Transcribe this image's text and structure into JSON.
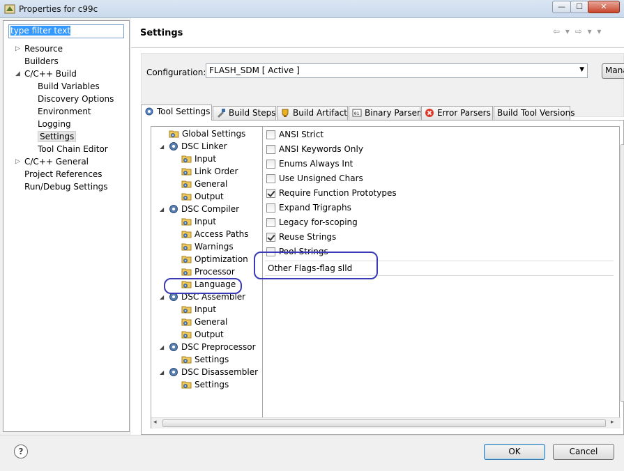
{
  "window": {
    "title": "Properties for c99c"
  },
  "filter": {
    "value": "type filter text"
  },
  "left_tree": [
    {
      "label": "Resource",
      "twisty": "collapsed"
    },
    {
      "label": "Builders"
    },
    {
      "label": "C/C++ Build",
      "twisty": "expanded"
    },
    {
      "label": "Build Variables"
    },
    {
      "label": "Discovery Options"
    },
    {
      "label": "Environment"
    },
    {
      "label": "Logging"
    },
    {
      "label": "Settings",
      "selected": true
    },
    {
      "label": "Tool Chain Editor"
    },
    {
      "label": "C/C++ General",
      "twisty": "collapsed"
    },
    {
      "label": "Project References"
    },
    {
      "label": "Run/Debug Settings"
    }
  ],
  "header": {
    "title": "Settings",
    "nav_arrows": "⇦ ▾ ⇨ ▾ ▾"
  },
  "configuration": {
    "label": "Configuration:",
    "value": "FLASH_SDM  [ Active ]",
    "manage_label": "Manage Configurations..."
  },
  "tabs": [
    {
      "label": "Tool Settings",
      "icon": "tool-settings-icon",
      "active": true
    },
    {
      "label": "Build Steps",
      "icon": "build-steps-icon"
    },
    {
      "label": "Build Artifact",
      "icon": "build-artifact-icon"
    },
    {
      "label": "Binary Parsers",
      "icon": "binary-parsers-icon"
    },
    {
      "label": "Error Parsers",
      "icon": "error-parsers-icon"
    },
    {
      "label": "Build Tool Versions"
    }
  ],
  "tool_tree": [
    {
      "label": "Global Settings"
    },
    {
      "label": "DSC Linker"
    },
    {
      "label": "Input"
    },
    {
      "label": "Link Order"
    },
    {
      "label": "General"
    },
    {
      "label": "Output"
    },
    {
      "label": "DSC Compiler"
    },
    {
      "label": "Input"
    },
    {
      "label": "Access Paths"
    },
    {
      "label": "Warnings"
    },
    {
      "label": "Optimization"
    },
    {
      "label": "Processor"
    },
    {
      "label": "Language",
      "selected": true
    },
    {
      "label": "DSC Assembler"
    },
    {
      "label": "Input"
    },
    {
      "label": "General"
    },
    {
      "label": "Output"
    },
    {
      "label": "DSC Preprocessor"
    },
    {
      "label": "Settings"
    },
    {
      "label": "DSC Disassembler"
    },
    {
      "label": "Settings"
    }
  ],
  "options": [
    {
      "label": "ANSI Strict",
      "checked": false
    },
    {
      "label": "ANSI Keywords Only",
      "checked": false
    },
    {
      "label": "Enums Always Int",
      "checked": false
    },
    {
      "label": "Use Unsigned Chars",
      "checked": false
    },
    {
      "label": "Require Function Prototypes",
      "checked": true
    },
    {
      "label": "Expand Trigraphs",
      "checked": false
    },
    {
      "label": "Legacy for-scoping",
      "checked": false
    },
    {
      "label": "Reuse Strings",
      "checked": true
    },
    {
      "label": "Pool Strings",
      "checked": false
    }
  ],
  "other_flags": {
    "label": "Other Flags",
    "value": "-flag slld"
  },
  "buttons": {
    "help": "?",
    "ok": "OK",
    "cancel": "Cancel"
  },
  "colors": {
    "annotation": "#3a3ab8",
    "selection": "#3399ff"
  }
}
